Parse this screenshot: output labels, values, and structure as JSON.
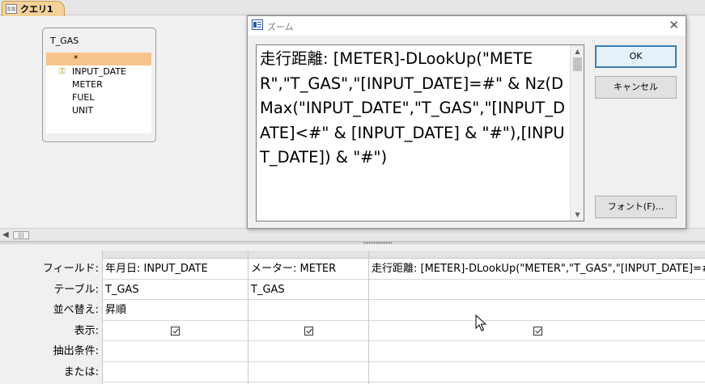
{
  "tab": {
    "title": "クエリ1",
    "icon": "query-icon"
  },
  "table": {
    "title": "T_GAS",
    "fields": [
      {
        "name": "*",
        "selected": true,
        "key": false
      },
      {
        "name": "INPUT_DATE",
        "selected": false,
        "key": true
      },
      {
        "name": "METER",
        "selected": false,
        "key": false
      },
      {
        "name": "FUEL",
        "selected": false,
        "key": false
      },
      {
        "name": "UNIT",
        "selected": false,
        "key": false
      }
    ]
  },
  "zoom_dialog": {
    "title": "ズーム",
    "text": "走行距離: [METER]-DLookUp(\"METER\",\"T_GAS\",\"[INPUT_DATE]=#\" & Nz(DMax(\"INPUT_DATE\",\"T_GAS\",\"[INPUT_DATE]<#\" & [INPUT_DATE] & \"#\"),[INPUT_DATE]) & \"#\")",
    "ok_label": "OK",
    "cancel_label": "キャンセル",
    "font_label": "フォント(F)..."
  },
  "grid": {
    "row_labels": [
      "フィールド:",
      "テーブル:",
      "並べ替え:",
      "表示:",
      "抽出条件:",
      "または:"
    ],
    "columns": [
      {
        "field": "年月日: INPUT_DATE",
        "table": "T_GAS",
        "sort": "昇順",
        "show": true,
        "criteria": "",
        "or": ""
      },
      {
        "field": "メーター: METER",
        "table": "T_GAS",
        "sort": "",
        "show": true,
        "criteria": "",
        "or": ""
      },
      {
        "field": "走行距離: [METER]-DLookUp(\"METER\",\"T_GAS\",\"[INPUT_DATE]=#\" & Nz(DMax(\"INPUT_DATE\",\"T_GAS\",\"[INPUT_DATE]<#\" & [INPUT_DATE] & \"#\"),[INPUT_DATE]) & \"#\")",
        "table": "",
        "sort": "",
        "show": true,
        "criteria": "",
        "or": ""
      }
    ]
  },
  "colors": {
    "tab_bg": "#f3d29a",
    "selected_field": "#f6c48c",
    "default_button_border": "#3c7fb1"
  }
}
